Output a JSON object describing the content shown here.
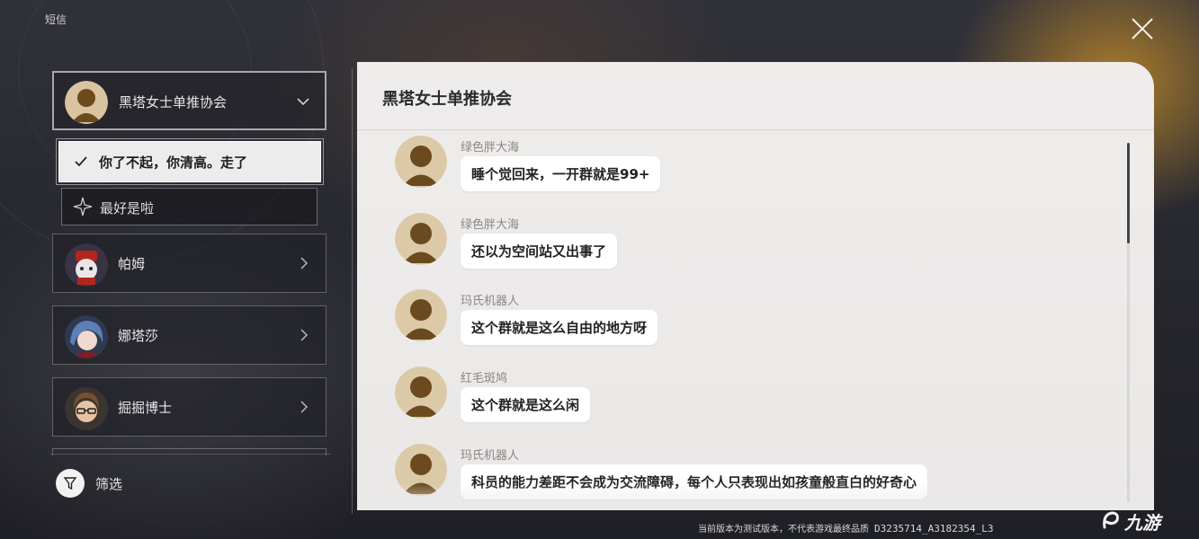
{
  "window": {
    "title": "短信"
  },
  "sidebar": {
    "conversations": [
      {
        "name": "黑塔女士单推协会",
        "active": true,
        "avatar": "silhouette-avatar"
      },
      {
        "name": "帕姆",
        "active": false,
        "avatar": "pom-pom-avatar"
      },
      {
        "name": "娜塔莎",
        "active": false,
        "avatar": "natasha-avatar"
      },
      {
        "name": "掘掘博士",
        "active": false,
        "avatar": "doctor-avatar"
      }
    ],
    "reply_options": [
      {
        "text": "你了不起，你清高。走了",
        "selected": true,
        "icon": "check-icon"
      },
      {
        "text": "最好是啦",
        "selected": false,
        "icon": "star-icon"
      }
    ],
    "filter_label": "筛选"
  },
  "chat": {
    "title": "黑塔女士单推协会",
    "messages": [
      {
        "sender": "绿色胖大海",
        "text": "睡个觉回来，一开群就是99+"
      },
      {
        "sender": "绿色胖大海",
        "text": "还以为空间站又出事了"
      },
      {
        "sender": "玛氏机器人",
        "text": "这个群就是这么自由的地方呀"
      },
      {
        "sender": "红毛斑鸠",
        "text": "这个群就是这么闲"
      },
      {
        "sender": "玛氏机器人",
        "text": "科员的能力差距不会成为交流障碍，每个人只表现出如孩童般直白的好奇心"
      }
    ]
  },
  "footer": {
    "build_notice": "当前版本为测试版本，不代表游戏最终品质",
    "build_code": "D3235714_A3182354_L3"
  },
  "watermark": {
    "text": "九游"
  },
  "colors": {
    "panel_bg": "#eeecea",
    "bubble_bg": "#ffffff",
    "selected_option_bg": "#ececec",
    "accent_orange": "#d69628"
  }
}
